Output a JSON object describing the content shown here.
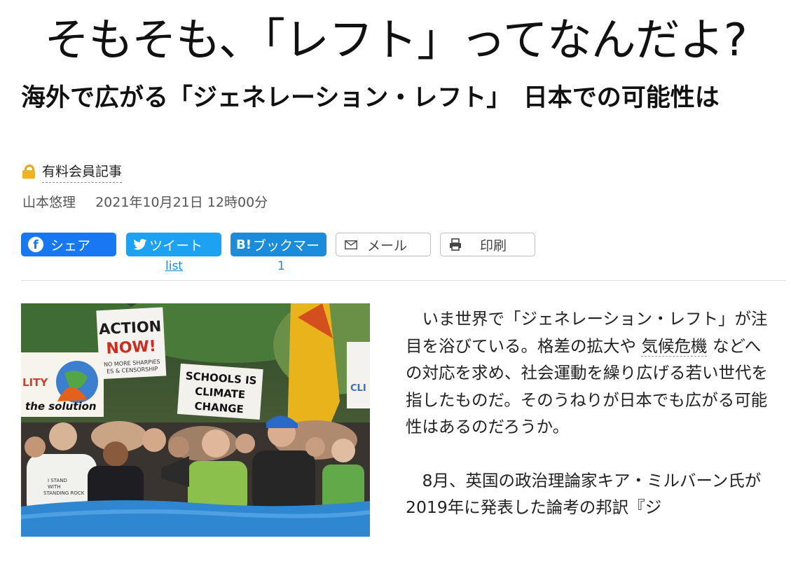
{
  "banner": {
    "text": "そもそも、「レフト」ってなんだよ?"
  },
  "article": {
    "title": "海外で広がる「ジェネレーション・レフト」　日本での可能性は",
    "paid_label": "有料会員記事",
    "author": "山本悠理",
    "published": "2021年10月21日 12時00分",
    "share": {
      "facebook_label": "シェア",
      "twitter_label": "ツイート",
      "twitter_count": "list",
      "hatena_mark": "B!",
      "hatena_label": "ブックマー",
      "hatena_count": "1",
      "mail_label": "メール",
      "print_label": "印刷"
    },
    "body": {
      "p1_a": "いま世界で「ジェネレーション・レフト」が注目を浴びている。格差の拡大や",
      "p1_term": "気候危機",
      "p1_b": "などへの対応を求め、社会運動を繰り広げる若い世代を指したものだ。そのうねりが日本でも広がる可能性はあるのだろうか。",
      "p2": "8月、英国の政治理論家キア・ミルバーン氏が2019年に発表した論考の邦訳『ジ"
    },
    "photo": {
      "sign_1": "ACTION NOW!",
      "sign_1_small": "NO MORE SHARPIES / ES & CENSORSHIP",
      "sign_2": "SCHOOLS IS CLIMATE CHANGE",
      "sign_3": "the solution",
      "sign_4": "LITY",
      "sign_5": "CLI",
      "shirt": "I STAND WITH STANDING ROCK"
    }
  },
  "colors": {
    "facebook": "#1877f2",
    "twitter": "#1da1f2",
    "hatena": "#1a8cdb",
    "lock": "#f0b21f",
    "link": "#1b8ad4"
  }
}
